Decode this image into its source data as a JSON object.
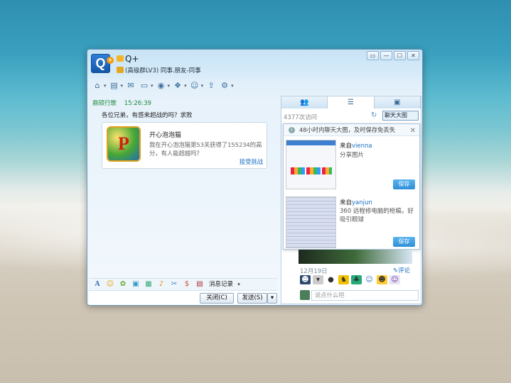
{
  "window": {
    "title": "Q+",
    "group_info": "(高级群LV3) 同事.朋友-同事",
    "logo_text": "Q",
    "logo_badge": "+",
    "controls": [
      "▭",
      "—",
      "☐",
      "✕"
    ]
  },
  "toolbar": {
    "items": [
      {
        "icon": "home-icon",
        "glyph": "⌂"
      },
      {
        "icon": "folder-icon",
        "glyph": "▤"
      },
      {
        "icon": "chat-icon",
        "glyph": "✉"
      },
      {
        "icon": "screen-icon",
        "glyph": "▭"
      },
      {
        "icon": "video-icon",
        "glyph": "◉"
      },
      {
        "icon": "app-icon",
        "glyph": "❖"
      },
      {
        "icon": "person-icon",
        "glyph": "☺"
      },
      {
        "icon": "share-icon",
        "glyph": "⇪"
      },
      {
        "icon": "settings-icon",
        "glyph": "⚙"
      }
    ]
  },
  "chat": {
    "sender": "鼎硕行歌",
    "time": "15:26:39",
    "text": "各位兄弟，有感来超战的吗？求败",
    "card": {
      "icon_letter": "P",
      "title": "开心泡泡猫",
      "desc": "我在开心泡泡猫第53关获得了155234的高分，有人能超越吗？",
      "action": "接受挑战"
    }
  },
  "format_bar": {
    "history_label": "消息记录"
  },
  "buttons": {
    "close": "关闭(C)",
    "send": "发送(S)",
    "send_menu": "▾"
  },
  "side_panel": {
    "tabs": [
      "👥",
      "☰",
      "▣"
    ],
    "visit_count": "4377次访问",
    "big_chat_label": "聊天大图",
    "notice": "48小时内聊天大图，及时保存免丢失",
    "items": [
      {
        "from_label": "来自",
        "user": "vienna",
        "desc": "分享图片",
        "save": "保存"
      },
      {
        "from_label": "来自",
        "user": "yanjun",
        "desc": "360 远程修电脑的枪稿，好吸引眼球",
        "save": "保存"
      }
    ],
    "date": "12月19日",
    "comment": "评论",
    "say_placeholder": "说点什么吧"
  }
}
